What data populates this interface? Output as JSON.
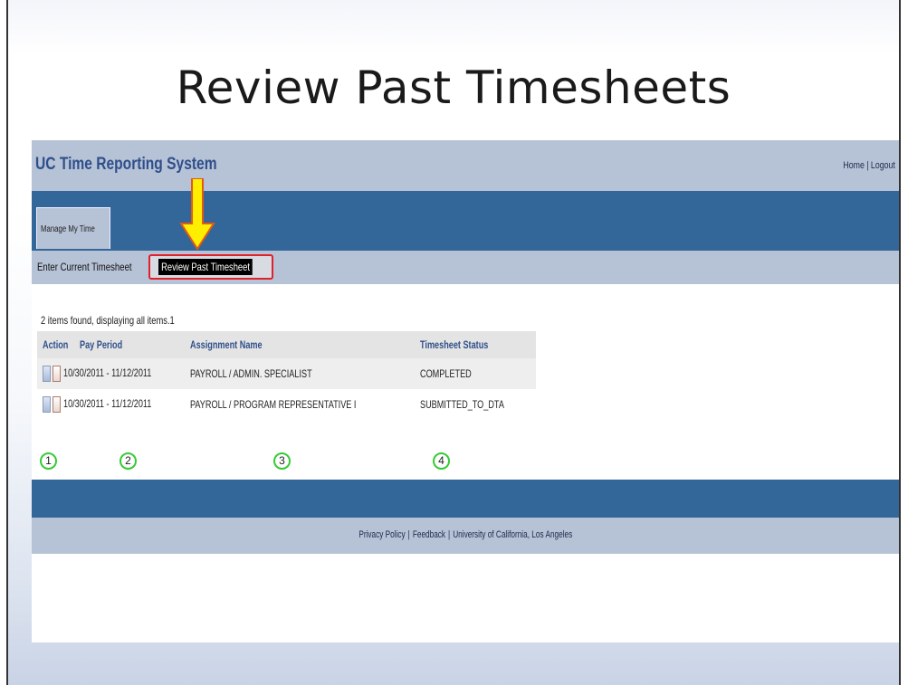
{
  "slide": {
    "title": "Review Past Timesheets"
  },
  "app": {
    "title": "UC Time Reporting System",
    "header_links": [
      "Home",
      "Logout"
    ],
    "tab": "Manage My Time",
    "subnav": {
      "current": "Enter Current Timesheet",
      "past": "Review Past Timesheet"
    }
  },
  "results": {
    "summary": "2 items found, displaying all items.1",
    "columns": {
      "action": "Action",
      "pay_period": "Pay Period",
      "assignment": "Assignment Name",
      "status": "Timesheet Status"
    },
    "rows": [
      {
        "pay_period": "10/30/2011 - 11/12/2011",
        "assignment": "PAYROLL / ADMIN. SPECIALIST",
        "status": "COMPLETED"
      },
      {
        "pay_period": "10/30/2011 - 11/12/2011",
        "assignment": "PAYROLL / PROGRAM REPRESENTATIVE I",
        "status": "SUBMITTED_TO_DTA"
      }
    ],
    "callouts": [
      "1",
      "2",
      "3",
      "4"
    ]
  },
  "footer": {
    "links": [
      "Privacy Policy",
      "Feedback",
      "University of California, Los Angeles"
    ]
  },
  "colors": {
    "nav": "#336699",
    "header": "#b6c2d6",
    "highlight": "#e0202a",
    "arrow": "#ffee00",
    "callout": "#33cc33"
  },
  "icons": {
    "arrow": "arrow-down-icon",
    "action": "timesheet-view-icon"
  }
}
